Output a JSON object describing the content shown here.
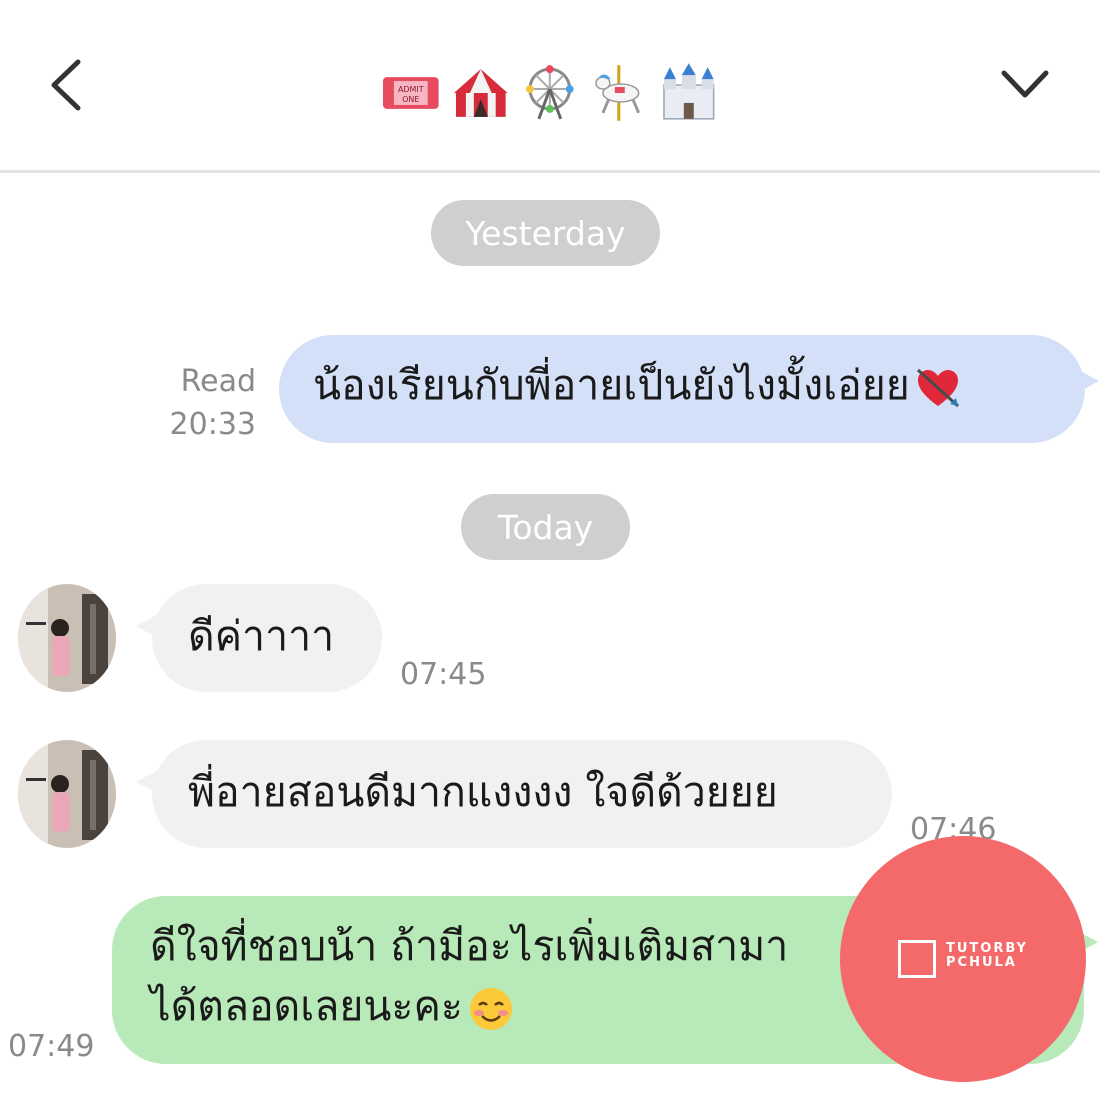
{
  "header": {
    "back_icon": "chevron-left-icon",
    "title_emojis": [
      "admit-one-ticket-icon",
      "circus-tent-icon",
      "ferris-wheel-icon",
      "carousel-horse-icon",
      "castle-icon"
    ],
    "menu_icon": "chevron-down-icon"
  },
  "dates": {
    "yesterday": "Yesterday",
    "today": "Today"
  },
  "messages": [
    {
      "direction": "outgoing",
      "text": "น้องเรียนกับพี่อายเป็นยังไงมั้งเอ่ยย",
      "emoji": "heart-with-arrow-icon",
      "status": "Read",
      "time": "20:33",
      "color": "#d4e0f7"
    },
    {
      "direction": "incoming",
      "text": "ดีค่าาาา",
      "time": "07:45",
      "color": "#f0f1f3"
    },
    {
      "direction": "incoming",
      "text": "พี่อายสอนดีมากแงงงง ใจดีด้วยยย",
      "time": "07:46",
      "color": "#f0f1f3"
    },
    {
      "direction": "outgoing",
      "text": "ดีใจที่ชอบน้า ถ้ามีอะไรเพิ่มเติมสามา",
      "text_line2": "ได้ตลอดเลยนะคะ",
      "emoji": "smiling-face-icon",
      "time": "07:49",
      "color": "#b8e9b8"
    }
  ],
  "watermark": {
    "line1": "TUTORBY",
    "line2": "PCHULA",
    "color": "#f46a6a"
  }
}
